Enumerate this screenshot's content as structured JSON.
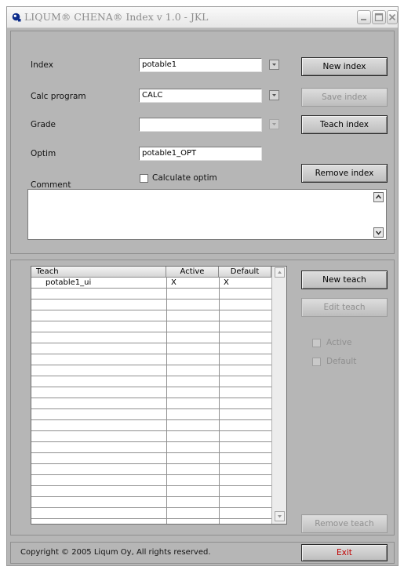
{
  "window": {
    "title": "LIQUM® CHENA® Index v 1.0 - JKL",
    "icons": [
      "liqum-app-icon",
      "minimize-icon",
      "maximize-icon",
      "close-icon"
    ]
  },
  "form": {
    "index_label": "Index",
    "index_value": "potable1",
    "calc_label": "Calc program",
    "calc_value": "CALC",
    "grade_label": "Grade",
    "grade_value": "",
    "optim_label": "Optim",
    "optim_value": "potable1_OPT",
    "calculate_optim_label": "Calculate optim",
    "calculate_optim_checked": false,
    "comment_label": "Comment",
    "comment_value": ""
  },
  "index_buttons": {
    "new_index": "New index",
    "save_index": "Save index",
    "teach_index": "Teach index",
    "remove_index": "Remove index"
  },
  "teach_table": {
    "columns": [
      "Teach",
      "Active",
      "Default"
    ],
    "rows": [
      [
        "potable1_ui",
        "X",
        "X"
      ]
    ]
  },
  "teach_controls": {
    "new_teach": "New teach",
    "edit_teach": "Edit teach",
    "active_label": "Active",
    "default_label": "Default",
    "remove_teach": "Remove teach"
  },
  "footer": {
    "copyright": "Copyright © 2005 Liqum Oy, All rights reserved.",
    "exit_label": "Exit"
  },
  "colors": {
    "window_bg": "#b6b6b6",
    "exit_text": "#c00000",
    "title_text": "#8d8d8d",
    "disabled_text": "#8f8f8f"
  }
}
